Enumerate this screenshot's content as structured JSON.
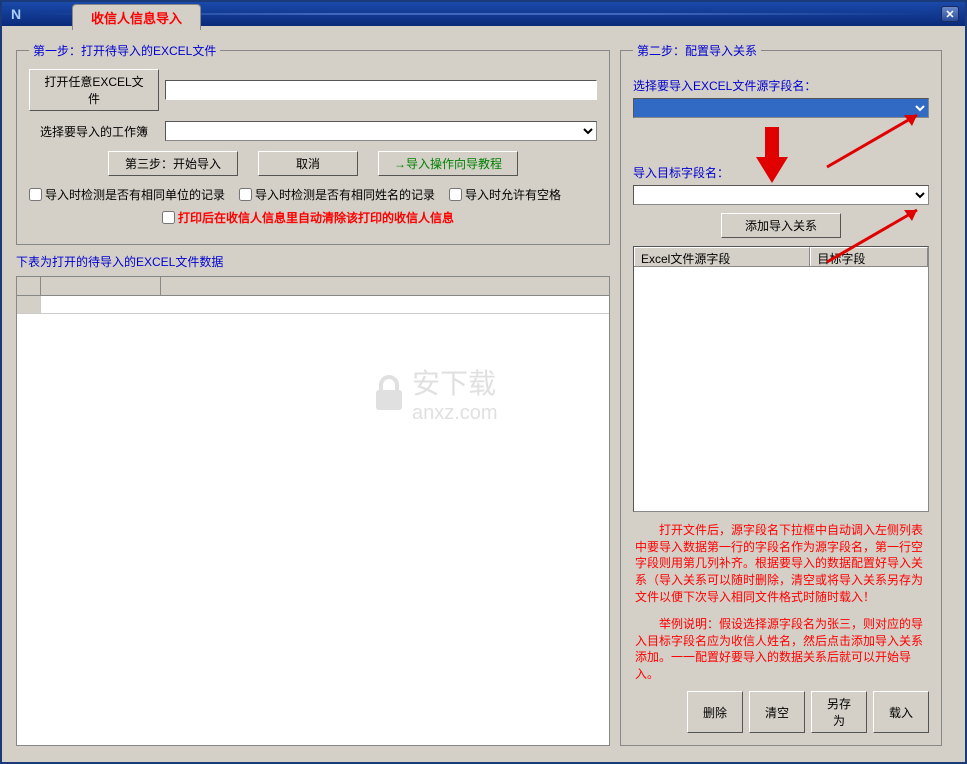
{
  "window": {
    "title": "收信人信息导入"
  },
  "step1": {
    "legend": "第一步：打开待导入的EXCEL文件",
    "open_btn": "打开任意EXCEL文件",
    "file_path": "",
    "sheet_label": "选择要导入的工作簿",
    "sheet_value": "",
    "start_btn": "第三步：开始导入",
    "cancel_btn": "取消",
    "wizard_btn": "→导入操作向导教程",
    "chk_unit": "导入时检测是否有相同单位的记录",
    "chk_name": "导入时检测是否有相同姓名的记录",
    "chk_blank": "导入时允许有空格",
    "chk_clear": "打印后在收信人信息里自动清除该打印的收信人信息"
  },
  "left_table_label": "下表为打开的待导入的EXCEL文件数据",
  "step2": {
    "legend": "第二步：配置导入关系",
    "src_label": "选择要导入EXCEL文件源字段名：",
    "src_value": "",
    "tgt_label": "导入目标字段名：",
    "tgt_value": "",
    "add_btn": "添加导入关系",
    "col_src": "Excel文件源字段",
    "col_tgt": "目标字段",
    "help1": "　　打开文件后，源字段名下拉框中自动调入左侧列表中要导入数据第一行的字段名作为源字段名，第一行空字段则用第几列补齐。根据要导入的数据配置好导入关系（导入关系可以随时删除，清空或将导入关系另存为文件以便下次导入相同文件格式时随时载入！",
    "help2": "　　举例说明：假设选择源字段名为张三，则对应的导入目标字段名应为收信人姓名，然后点击添加导入关系添加。一一配置好要导入的数据关系后就可以开始导入。",
    "del_btn": "删除",
    "clear_btn": "清空",
    "saveas_btn": "另存为",
    "load_btn": "载入"
  },
  "watermark": {
    "main": "安下载",
    "sub": "anxz.com"
  }
}
